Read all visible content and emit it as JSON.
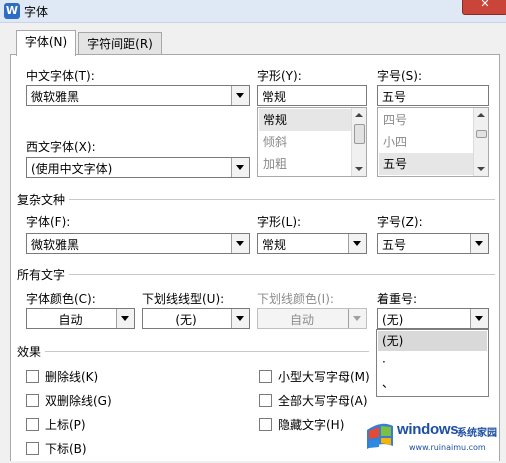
{
  "window": {
    "app_icon_glyph": "W",
    "title": "字体",
    "close_glyph": "✕"
  },
  "tabs": [
    {
      "label": "字体(N)"
    },
    {
      "label": "字符间距(R)"
    }
  ],
  "font": {
    "chinese_label": "中文字体(T):",
    "chinese_value": "微软雅黑",
    "western_label": "西文字体(X):",
    "western_value": "(使用中文字体)",
    "style_label": "字形(Y):",
    "style_value": "常规",
    "style_list": [
      "常规",
      "倾斜",
      "加粗"
    ],
    "size_label": "字号(S):",
    "size_value": "五号",
    "size_list": [
      "四号",
      "小四",
      "五号"
    ]
  },
  "complex": {
    "heading": "复杂文种",
    "font_label": "字体(F):",
    "font_value": "微软雅黑",
    "style_label": "字形(L):",
    "style_value": "常规",
    "size_label": "字号(Z):",
    "size_value": "五号"
  },
  "all_text": {
    "heading": "所有文字",
    "color_label": "字体颜色(C):",
    "color_value": "自动",
    "underline_label": "下划线线型(U):",
    "underline_value": "(无)",
    "underline_color_label": "下划线颜色(I):",
    "underline_color_value": "自动",
    "emphasis_label": "着重号:",
    "emphasis_value": "(无)",
    "emphasis_options": [
      "(无)",
      "·",
      "、"
    ]
  },
  "effects": {
    "heading": "效果",
    "left": [
      "删除线(K)",
      "双删除线(G)",
      "上标(P)",
      "下标(B)"
    ],
    "right": [
      "小型大写字母(M)",
      "全部大写字母(A)",
      "隐藏文字(H)"
    ]
  },
  "watermark": {
    "brand": "windows",
    "suffix": "系统家园",
    "url": "www.ruinaimu.com"
  },
  "colors": {
    "title_bar": "#dfe8f5",
    "close_button": "#c9453a",
    "list_selection": "#e6e6e6",
    "watermark_blue": "#1d4fa3"
  }
}
